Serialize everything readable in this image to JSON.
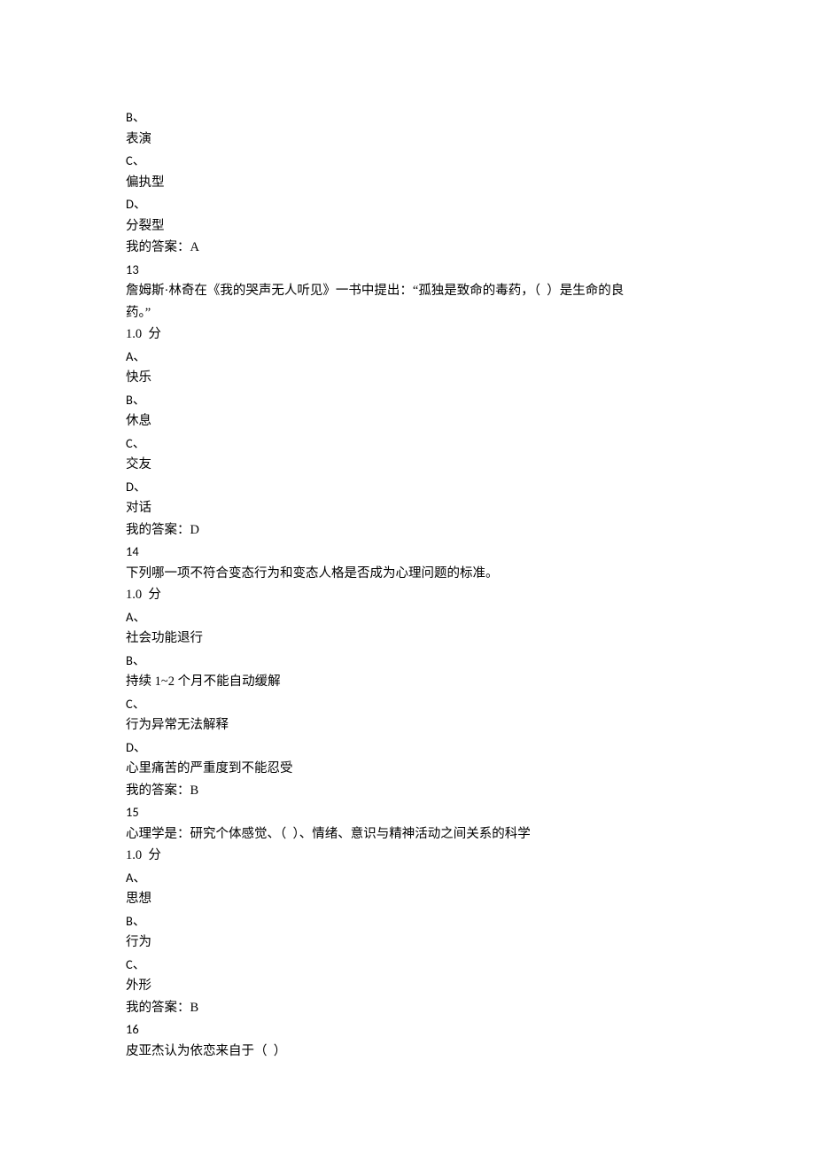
{
  "lines": [
    {
      "name": "opt-b-label",
      "text": "B、",
      "class": "latin"
    },
    {
      "name": "opt-b-text",
      "text": "表演",
      "class": "cjk"
    },
    {
      "name": "opt-c-label",
      "text": "C、",
      "class": "latin"
    },
    {
      "name": "opt-c-text",
      "text": "偏执型",
      "class": "cjk"
    },
    {
      "name": "opt-d-label",
      "text": "D、",
      "class": "latin"
    },
    {
      "name": "opt-d-text",
      "text": "分裂型",
      "class": "cjk"
    },
    {
      "name": "my-answer-12",
      "text": "我的答案：A",
      "class": "cjk"
    },
    {
      "name": "q13-number",
      "text": "13",
      "class": "latin"
    },
    {
      "name": "q13-stem-1",
      "text": "詹姆斯·林奇在《我的哭声无人听见》一书中提出：“孤独是致命的毒药，（  ）是生命的良",
      "class": "cjk"
    },
    {
      "name": "q13-stem-2",
      "text": "药。”",
      "class": "cjk"
    },
    {
      "name": "q13-score",
      "text": "1.0  分",
      "class": "cjk"
    },
    {
      "name": "q13-a-label",
      "text": "A、",
      "class": "latin"
    },
    {
      "name": "q13-a-text",
      "text": "快乐",
      "class": "cjk"
    },
    {
      "name": "q13-b-label",
      "text": "B、",
      "class": "latin"
    },
    {
      "name": "q13-b-text",
      "text": "休息",
      "class": "cjk"
    },
    {
      "name": "q13-c-label",
      "text": "C、",
      "class": "latin"
    },
    {
      "name": "q13-c-text",
      "text": "交友",
      "class": "cjk"
    },
    {
      "name": "q13-d-label",
      "text": "D、",
      "class": "latin"
    },
    {
      "name": "q13-d-text",
      "text": "对话",
      "class": "cjk"
    },
    {
      "name": "my-answer-13",
      "text": "我的答案：D",
      "class": "cjk"
    },
    {
      "name": "q14-number",
      "text": "14",
      "class": "latin"
    },
    {
      "name": "q14-stem",
      "text": "下列哪一项不符合变态行为和变态人格是否成为心理问题的标准。",
      "class": "cjk"
    },
    {
      "name": "q14-score",
      "text": "1.0  分",
      "class": "cjk"
    },
    {
      "name": "q14-a-label",
      "text": "A、",
      "class": "latin"
    },
    {
      "name": "q14-a-text",
      "text": "社会功能退行",
      "class": "cjk"
    },
    {
      "name": "q14-b-label",
      "text": "B、",
      "class": "latin"
    },
    {
      "name": "q14-b-text",
      "text": "持续 1~2 个月不能自动缓解",
      "class": "cjk"
    },
    {
      "name": "q14-c-label",
      "text": "C、",
      "class": "latin"
    },
    {
      "name": "q14-c-text",
      "text": "行为异常无法解释",
      "class": "cjk"
    },
    {
      "name": "q14-d-label",
      "text": "D、",
      "class": "latin"
    },
    {
      "name": "q14-d-text",
      "text": "心里痛苦的严重度到不能忍受",
      "class": "cjk"
    },
    {
      "name": "my-answer-14",
      "text": "我的答案：B",
      "class": "cjk"
    },
    {
      "name": "q15-number",
      "text": "15",
      "class": "latin"
    },
    {
      "name": "q15-stem",
      "text": "心理学是：研究个体感觉、（  ）、情绪、意识与精神活动之间关系的科学",
      "class": "cjk"
    },
    {
      "name": "q15-score",
      "text": "1.0  分",
      "class": "cjk"
    },
    {
      "name": "q15-a-label",
      "text": "A、",
      "class": "latin"
    },
    {
      "name": "q15-a-text",
      "text": "思想",
      "class": "cjk"
    },
    {
      "name": "q15-b-label",
      "text": "B、",
      "class": "latin"
    },
    {
      "name": "q15-b-text",
      "text": "行为",
      "class": "cjk"
    },
    {
      "name": "q15-c-label",
      "text": "C、",
      "class": "latin"
    },
    {
      "name": "q15-c-text",
      "text": "外形",
      "class": "cjk"
    },
    {
      "name": "my-answer-15",
      "text": "我的答案：B",
      "class": "cjk"
    },
    {
      "name": "q16-number",
      "text": "16",
      "class": "latin"
    },
    {
      "name": "q16-stem",
      "text": "皮亚杰认为依恋来自于（  ）",
      "class": "cjk"
    }
  ]
}
